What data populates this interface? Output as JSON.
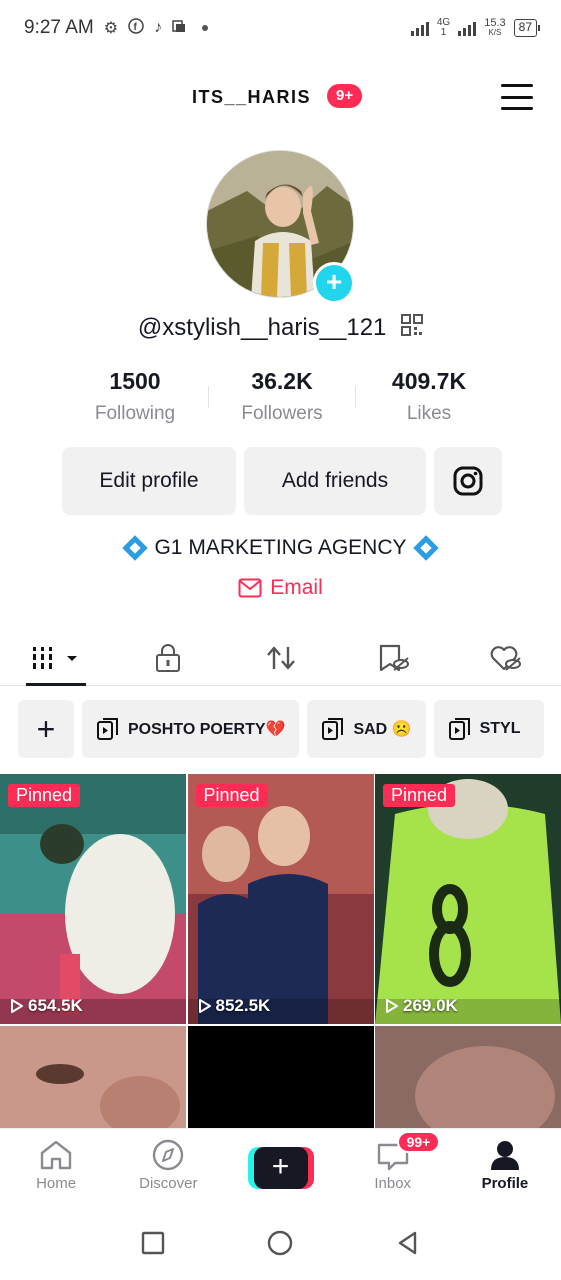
{
  "status_bar": {
    "time": "9:27 AM",
    "network_type": "4G",
    "network_sub": "1",
    "speed": "15.3",
    "speed_unit": "K/S",
    "battery": "87",
    "icons": [
      "gear-icon",
      "facebook-icon",
      "tiktok-icon",
      "app-icon"
    ]
  },
  "header": {
    "username": "ITS__HARIS",
    "badge": "9+"
  },
  "profile": {
    "handle": "@xstylish__haris__121",
    "stats": [
      {
        "value": "1500",
        "label": "Following"
      },
      {
        "value": "36.2K",
        "label": "Followers"
      },
      {
        "value": "409.7K",
        "label": "Likes"
      }
    ],
    "buttons": {
      "edit": "Edit profile",
      "add_friends": "Add friends"
    },
    "bio": "G1 MARKETING AGENCY",
    "email_label": "Email"
  },
  "playlists": [
    {
      "label": "POSHTO POERTY💔"
    },
    {
      "label": "SAD ☹️"
    },
    {
      "label": "STYL"
    }
  ],
  "videos": [
    {
      "pinned": "Pinned",
      "views": "654.5K"
    },
    {
      "pinned": "Pinned",
      "views": "852.5K"
    },
    {
      "pinned": "Pinned",
      "views": "269.0K"
    }
  ],
  "bottom_nav": {
    "home": "Home",
    "discover": "Discover",
    "inbox": "Inbox",
    "inbox_badge": "99+",
    "profile": "Profile"
  },
  "colors": {
    "accent": "#fe2c55",
    "cyan": "#20d5ec",
    "text": "#161823",
    "muted": "#8a8b91",
    "button_bg": "#f1f1f2"
  }
}
